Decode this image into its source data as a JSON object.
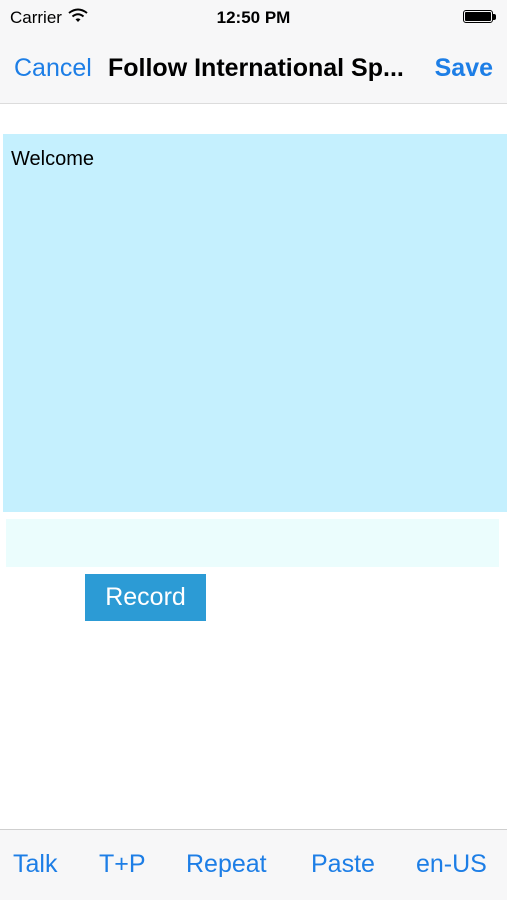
{
  "status_bar": {
    "carrier": "Carrier",
    "time": "12:50 PM",
    "icons": [
      "wifi-icon",
      "battery-icon"
    ]
  },
  "nav_bar": {
    "cancel_label": "Cancel",
    "title": "Follow International Sp...",
    "save_label": "Save"
  },
  "main": {
    "text_content": "Welcome",
    "input_value": "",
    "record_label": "Record"
  },
  "toolbar": {
    "items": [
      {
        "label": "Talk"
      },
      {
        "label": "T+P"
      },
      {
        "label": "Repeat"
      },
      {
        "label": "Paste"
      },
      {
        "label": "en-US"
      }
    ]
  },
  "colors": {
    "accent": "#1d7ee6",
    "text_area_bg": "#c5f0fe",
    "input_bg": "#ebfdfd",
    "record_bg": "#2c9bd5",
    "bar_bg": "#f7f7f8"
  }
}
